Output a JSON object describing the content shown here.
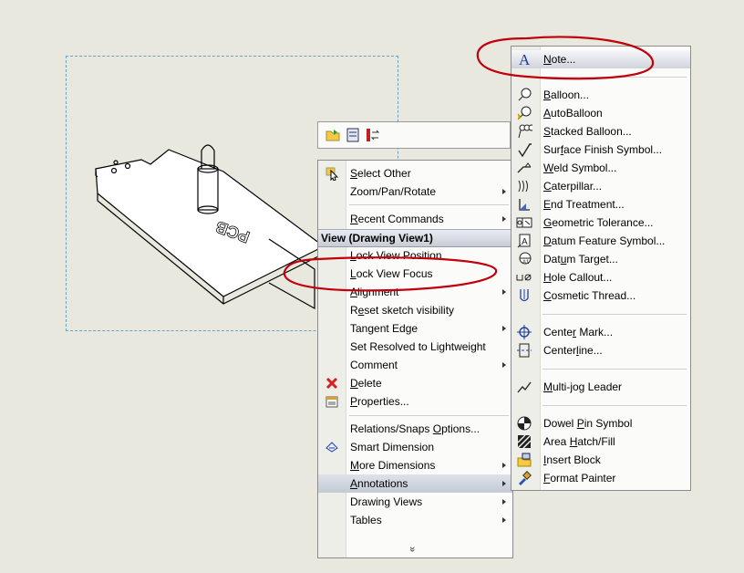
{
  "toolbar": {
    "icons": [
      "open-folder-icon",
      "zoom-sheet-icon",
      "swap-icon"
    ]
  },
  "menu": {
    "header": "View (Drawing View1)",
    "items": [
      {
        "label": "Select Other",
        "u": "S",
        "icon": "select-arrow-icon",
        "submenu": false
      },
      {
        "label": "Zoom/Pan/Rotate",
        "submenu": true
      },
      {
        "label": "Recent Commands",
        "u": "R",
        "submenu": true
      },
      {
        "label": "Lock View Position",
        "u": "L",
        "submenu": false
      },
      {
        "label": "Lock View Focus",
        "u": "L",
        "submenu": false
      },
      {
        "label": "Alignment",
        "u": "A",
        "submenu": true
      },
      {
        "label": "Reset sketch visibility",
        "u": "e",
        "submenu": false
      },
      {
        "label": "Tangent Edge",
        "submenu": true
      },
      {
        "label": "Set Resolved to Lightweight",
        "submenu": false
      },
      {
        "label": "Comment",
        "submenu": true
      },
      {
        "label": "Delete",
        "u": "D",
        "icon": "delete-x-icon",
        "submenu": false
      },
      {
        "label": "Properties...",
        "u": "P",
        "icon": "properties-icon",
        "submenu": false
      },
      {
        "label": "Relations/Snaps Options...",
        "u": "O",
        "submenu": false
      },
      {
        "label": "Smart Dimension",
        "icon": "smart-dimension-icon",
        "submenu": false
      },
      {
        "label": "More Dimensions",
        "u": "M",
        "submenu": true
      },
      {
        "label": "Annotations",
        "u": "A",
        "submenu": true
      },
      {
        "label": "Drawing Views",
        "submenu": true
      },
      {
        "label": "Tables",
        "submenu": true
      }
    ],
    "more_glyph": "»"
  },
  "annotations": {
    "items": [
      {
        "label": "Note...",
        "u": "N",
        "icon": "note-A-icon"
      },
      {
        "label": "Balloon...",
        "u": "B",
        "icon": "balloon-icon"
      },
      {
        "label": "AutoBalloon",
        "u": "A",
        "icon": "autoballoon-icon"
      },
      {
        "label": "Stacked Balloon...",
        "u": "S",
        "icon": "stacked-balloon-icon"
      },
      {
        "label": "Surface Finish Symbol...",
        "u": "f",
        "icon": "surface-finish-icon"
      },
      {
        "label": "Weld Symbol...",
        "u": "W",
        "icon": "weld-symbol-icon"
      },
      {
        "label": "Caterpillar...",
        "u": "C",
        "icon": "caterpillar-icon"
      },
      {
        "label": "End Treatment...",
        "u": "E",
        "icon": "end-treatment-icon"
      },
      {
        "label": "Geometric Tolerance...",
        "u": "G",
        "icon": "geometric-tolerance-icon"
      },
      {
        "label": "Datum Feature Symbol...",
        "u": "D",
        "icon": "datum-feature-icon"
      },
      {
        "label": "Datum Target...",
        "u": "u",
        "icon": "datum-target-icon"
      },
      {
        "label": "Hole Callout...",
        "u": "H",
        "icon": "hole-callout-icon"
      },
      {
        "label": "Cosmetic Thread...",
        "u": "C",
        "icon": "cosmetic-thread-icon"
      },
      {
        "label": "Center Mark...",
        "u": "r",
        "icon": "center-mark-icon"
      },
      {
        "label": "Centerline...",
        "u": "l",
        "icon": "centerline-icon"
      },
      {
        "label": "Multi-jog Leader",
        "u": "M",
        "icon": "multi-jog-leader-icon"
      },
      {
        "label": "Dowel Pin Symbol",
        "u": "P",
        "icon": "dowel-pin-icon"
      },
      {
        "label": "Area Hatch/Fill",
        "u": "H",
        "icon": "area-hatch-icon"
      },
      {
        "label": "Insert Block",
        "u": "I",
        "icon": "insert-block-icon"
      },
      {
        "label": "Format Painter",
        "u": "F",
        "icon": "format-painter-icon"
      }
    ]
  },
  "drawing": {
    "engraving": "PCB"
  },
  "colors": {
    "annotation_ellipse": "#c0000a",
    "header_bg": "#c7ccd6",
    "view_frame": "#6aa0c8"
  }
}
